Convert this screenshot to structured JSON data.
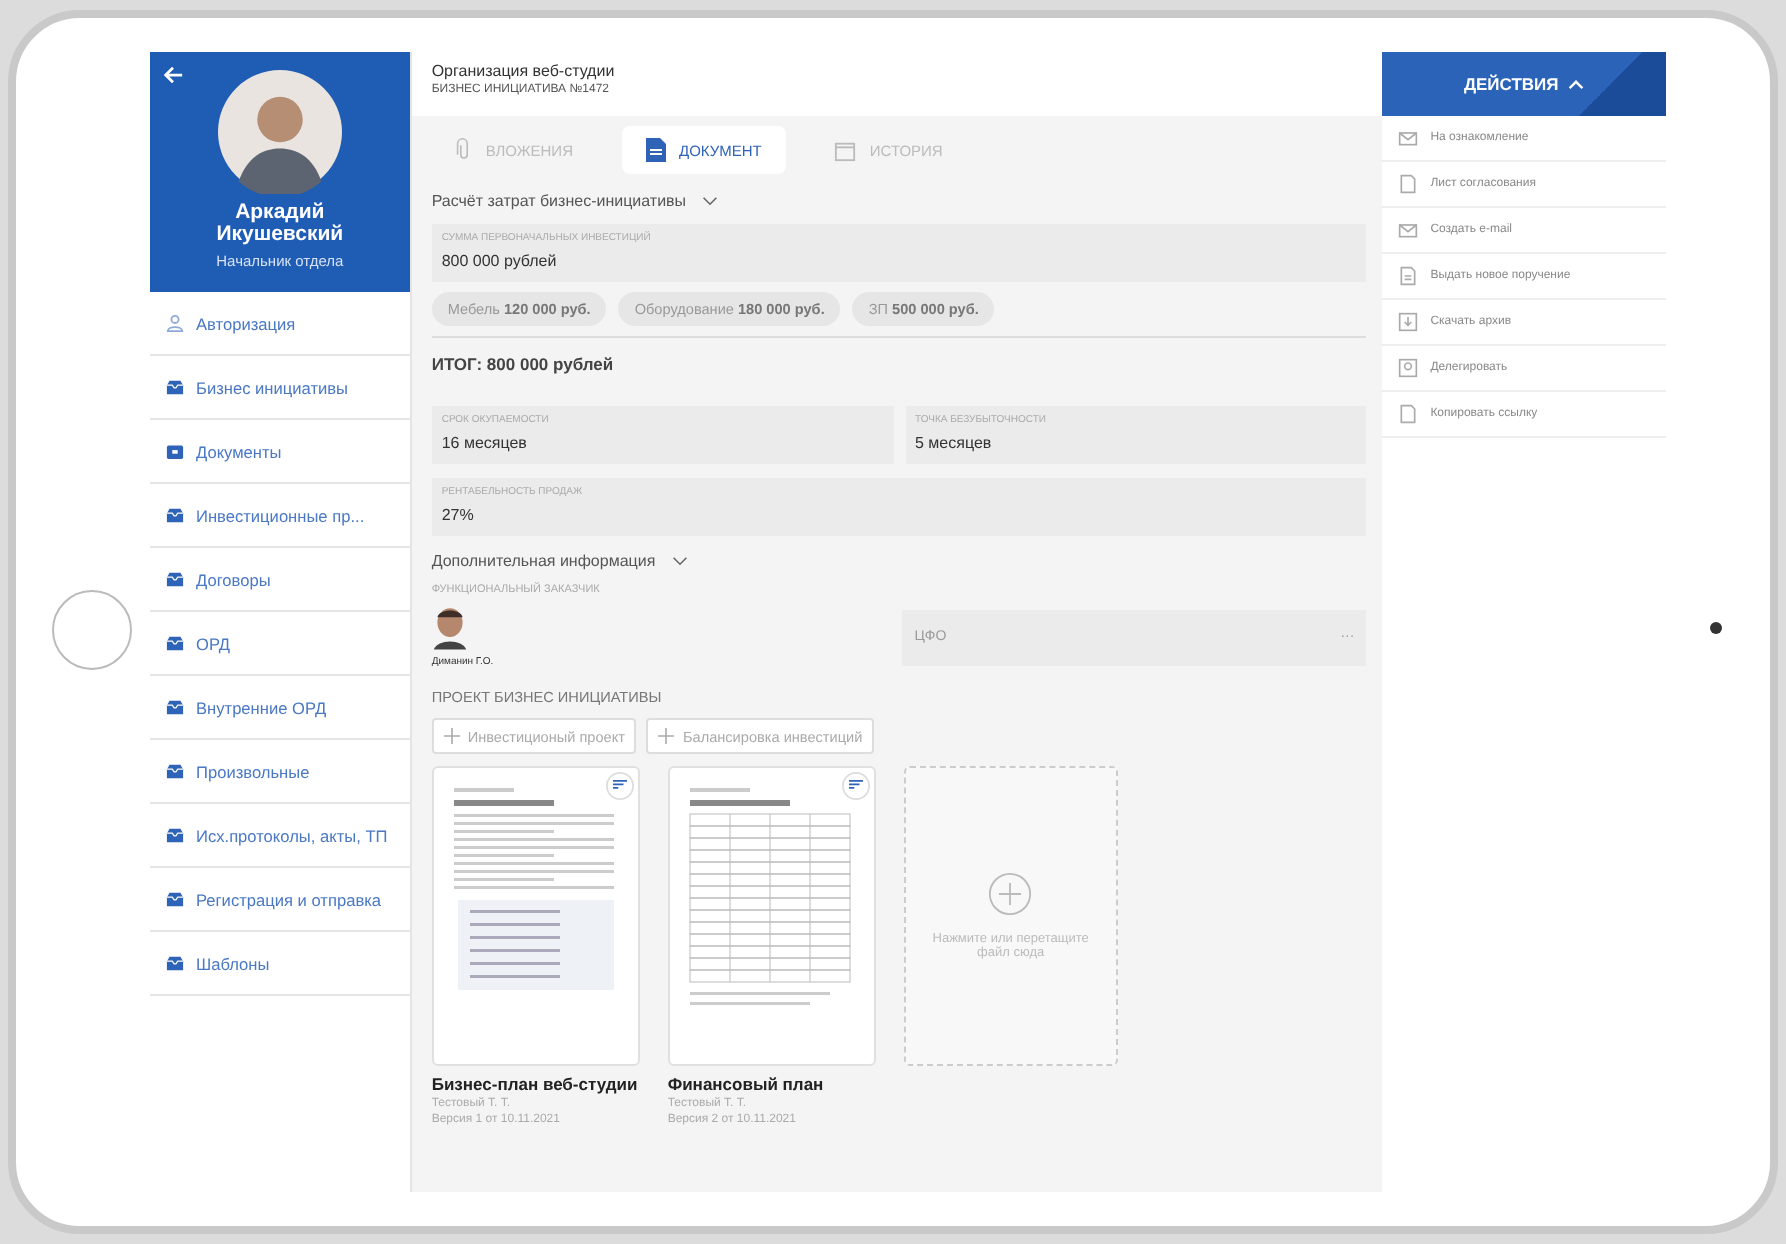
{
  "header": {
    "title": "Организация веб-студии",
    "subtitle": "БИЗНЕС ИНИЦИАТИВА  №1472"
  },
  "sidebar": {
    "user": {
      "name": "Аркадий Икушевский",
      "role": "Начальник отдела"
    },
    "items": [
      {
        "label": "Авторизация",
        "kind": "person"
      },
      {
        "label": "Бизнес инициативы",
        "kind": "tray"
      },
      {
        "label": "Документы",
        "kind": "case"
      },
      {
        "label": "Инвестиционные пр...",
        "kind": "tray"
      },
      {
        "label": "Договоры",
        "kind": "tray"
      },
      {
        "label": "ОРД",
        "kind": "tray"
      },
      {
        "label": "Внутренние ОРД",
        "kind": "tray"
      },
      {
        "label": "Произвольные",
        "kind": "tray"
      },
      {
        "label": "Исх.протоколы, акты, ТП",
        "kind": "tray"
      },
      {
        "label": "Регистрация и отправка",
        "kind": "tray"
      },
      {
        "label": "Шаблоны",
        "kind": "tray"
      }
    ]
  },
  "tabs": [
    {
      "label": "ВЛОЖЕНИЯ",
      "kind": "clip",
      "selected": false
    },
    {
      "label": "ДОКУМЕНТ",
      "kind": "doc",
      "selected": true
    },
    {
      "label": "ИСТОРИЯ",
      "kind": "calendar",
      "selected": false
    }
  ],
  "costs": {
    "title": "Расчёт затрат бизнес-инициативы",
    "field": {
      "label": "СУММА ПЕРВОНАЧАЛЬНЫХ ИНВЕСТИЦИЙ",
      "value": "800 000 рублей"
    },
    "chips": [
      "Мебель **120 000 руб.**",
      "Оборудование **180 000 руб.**",
      "ЗП **500 000 руб.**"
    ],
    "total": "ИТОГ:  800 000 рублей"
  },
  "metrics": [
    {
      "label": "СРОК ОКУПАЕМОСТИ",
      "value": "16 месяцев"
    },
    {
      "label": "ТОЧКА БЕЗУБЫТОЧНОСТИ",
      "value": "5 месяцев"
    },
    {
      "label": "РЕНТАБЕЛЬНОСТЬ ПРОДАЖ",
      "value": "27%"
    }
  ],
  "extra": {
    "title": "Дополнительная информация",
    "customer_label": "ФУНКЦИОНАЛЬНЫЙ ЗАКАЗЧИК",
    "customer_name": "Диманин Г.О.",
    "cfo_placeholder": "ЦФО",
    "cfo_more": "···"
  },
  "project": {
    "title": "ПРОЕКТ БИЗНЕС ИНИЦИАТИВЫ",
    "buttons": [
      "Инвестиционый проект",
      "Балансировка инвестиций"
    ],
    "files": [
      {
        "kind": "text",
        "title": "Бизнес-план веб-студии",
        "author": "Тестовый Т. Т.",
        "version": "Версия 1 от 10.11.2021"
      },
      {
        "kind": "table",
        "title": "Финансовый план",
        "author": "Тестовый Т. Т.",
        "version": "Версия 2 от 10.11.2021"
      }
    ],
    "upload": "Нажмите или перетащите файл сюда"
  },
  "actions": {
    "title": "ДЕЙСТВИЯ",
    "items": [
      {
        "label": "На ознакомление",
        "kind": "mail"
      },
      {
        "label": "Лист согласования",
        "kind": "sheet"
      },
      {
        "label": "Создать e-mail",
        "kind": "mail"
      },
      {
        "label": "Выдать новое поручение",
        "kind": "doc"
      },
      {
        "label": "Скачать архив",
        "kind": "download"
      },
      {
        "label": "Делегировать",
        "kind": "person"
      },
      {
        "label": "Копировать ссылку",
        "kind": "sheet"
      }
    ]
  }
}
